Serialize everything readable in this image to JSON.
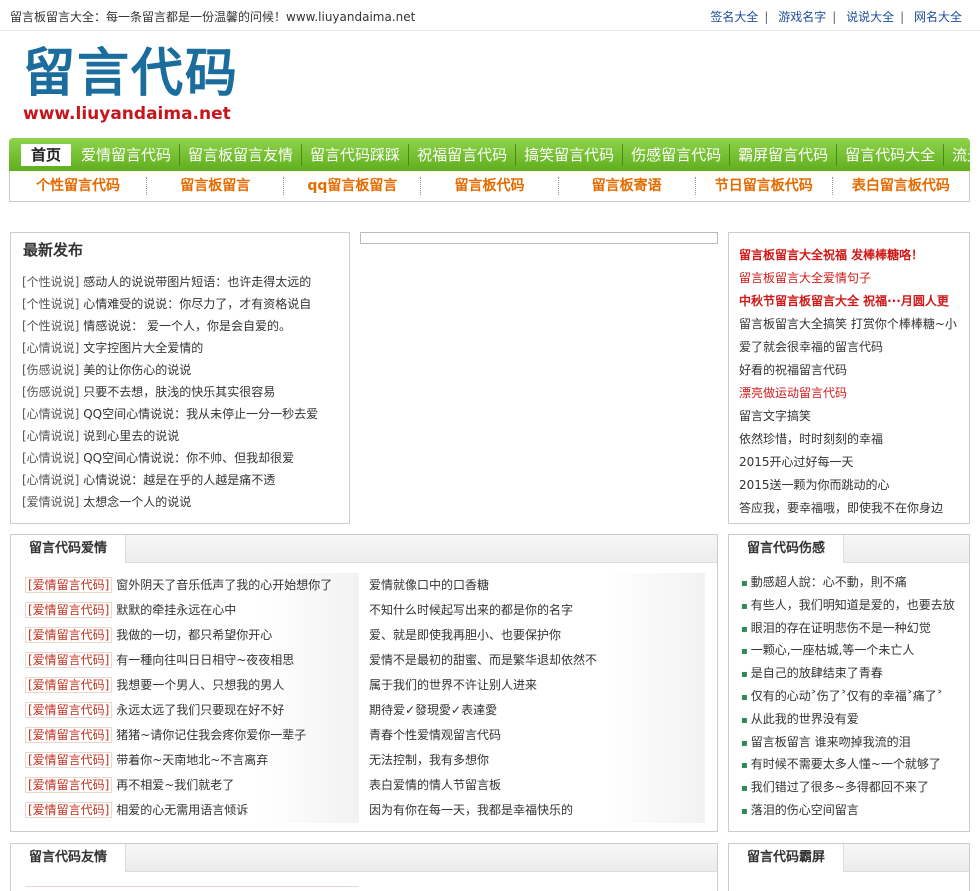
{
  "topbar": {
    "slogan": "留言板留言大全：每一条留言都是一份温馨的问候！www.liuyandaima.net",
    "links": [
      "签名大全",
      "游戏名字",
      "说说大全",
      "网名大全"
    ]
  },
  "logo": {
    "title": "留言代码",
    "url": "www.liuyandaima.net"
  },
  "nav": {
    "items": [
      "首页",
      "爱情留言代码",
      "留言板留言友情",
      "留言代码踩踩",
      "祝福留言代码",
      "搞笑留言代码",
      "伤感留言代码",
      "霸屏留言代码",
      "留言代码大全",
      "流光字"
    ]
  },
  "subnav": {
    "items": [
      "个性留言代码",
      "留言板留言",
      "qq留言板留言",
      "留言板代码",
      "留言板寄语",
      "节日留言板代码",
      "表白留言板代码"
    ]
  },
  "latest": {
    "title": "最新发布",
    "items": [
      {
        "cat": "[个性说说]",
        "text": " 感动人的说说带图片短语：也许走得太远的"
      },
      {
        "cat": "[个性说说]",
        "text": " 心情难受的说说：你尽力了，才有资格说自"
      },
      {
        "cat": "[个性说说]",
        "text": " 情感说说：  爱一个人，你是会自爱的。"
      },
      {
        "cat": "[心情说说]",
        "text": " 文字控图片大全爱情的"
      },
      {
        "cat": "[伤感说说]",
        "text": " 美的让你伤心的说说"
      },
      {
        "cat": "[伤感说说]",
        "text": " 只要不去想，肤浅的快乐其实很容易"
      },
      {
        "cat": "[心情说说]",
        "text": " QQ空间心情说说：我从未停止一分一秒去爱"
      },
      {
        "cat": "[心情说说]",
        "text": " 说到心里去的说说"
      },
      {
        "cat": "[心情说说]",
        "text": " QQ空间心情说说：你不帅、但我却很爱"
      },
      {
        "cat": "[心情说说]",
        "text": " 心情说说：越是在乎的人越是痛不透"
      },
      {
        "cat": "[爱情说说]",
        "text": " 太想念一个人的说说"
      }
    ]
  },
  "right_list": {
    "items": [
      {
        "text": "留言板留言大全祝福 发棒棒糖咯！",
        "red": true,
        "bold": true
      },
      {
        "text": "留言板留言大全爱情句子",
        "red": true,
        "bold": false
      },
      {
        "text": "中秋节留言板留言大全 祝福···月圆人更",
        "red": true,
        "bold": true
      },
      {
        "text": "留言板留言大全搞笑 打赏你个棒棒糖~小",
        "red": false,
        "bold": false
      },
      {
        "text": "爱了就会很幸福的留言代码",
        "red": false,
        "bold": false
      },
      {
        "text": "好看的祝福留言代码",
        "red": false,
        "bold": false
      },
      {
        "text": "漂亮做运动留言代码",
        "red": true,
        "bold": false
      },
      {
        "text": "留言文字搞笑",
        "red": false,
        "bold": false
      },
      {
        "text": "依然珍惜，时时刻刻的幸福",
        "red": false,
        "bold": false
      },
      {
        "text": "2015开心过好每一天",
        "red": false,
        "bold": false
      },
      {
        "text": "2015送一颗为你而跳动的心",
        "red": false,
        "bold": false
      },
      {
        "text": "答应我，要幸福哦，即使我不在你身边",
        "red": false,
        "bold": false
      }
    ]
  },
  "love": {
    "title": "留言代码爱情",
    "left": [
      {
        "cat": "[爱情留言代码]",
        "text": " 窗外阴天了音乐低声了我的心开始想你了"
      },
      {
        "cat": "[爱情留言代码]",
        "text": " 默默的牵挂永远在心中"
      },
      {
        "cat": "[爱情留言代码]",
        "text": " 我做的一切，都只希望你开心"
      },
      {
        "cat": "[爱情留言代码]",
        "text": " 有一種向往叫日日相守~夜夜相思"
      },
      {
        "cat": "[爱情留言代码]",
        "text": " 我想要一个男人、只想我的男人"
      },
      {
        "cat": "[爱情留言代码]",
        "text": " 永远太远了我们只要现在好不好"
      },
      {
        "cat": "[爱情留言代码]",
        "text": " 猪猪~请你记住我会疼你爱你一辈子"
      },
      {
        "cat": "[爱情留言代码]",
        "text": " 带着你~天南地北~不言离弃"
      },
      {
        "cat": "[爱情留言代码]",
        "text": " 再不相爱~我们就老了"
      },
      {
        "cat": "[爱情留言代码]",
        "text": " 相爱的心无需用语言倾诉"
      }
    ],
    "right": [
      "爱情就像口中的口香糖",
      "不知什么时候起写出来的都是你的名字",
      "爱、就是即使我再胆小、也要保护你",
      "爱情不是最初的甜蜜、而是繁华退却依然不",
      "属于我们的世界不许让别人进来",
      "期待爱✓發現愛✓表達愛",
      "青春个性爱情观留言代码",
      "无法控制，我有多想你",
      "表白爱情的情人节留言板",
      "因为有你在每一天，我都是幸福快乐的"
    ]
  },
  "sad": {
    "title": "留言代码伤感",
    "items": [
      "動感超人說：心不動，則不痛",
      "有些人，我们明知道是爱的，也要去放",
      "眼泪的存在证明悲伤不是一种幻觉",
      "一颗心,一座枯城,等一个未亡人",
      "是自己的放肆结束了青春",
      "仅有的心动˃伤了˃仅有的幸福˃痛了˃",
      "从此我的世界没有爱",
      "留言板留言 谁来吻掉我流的泪",
      "有时候不需要太多人懂~一个就够了",
      "我们错过了很多~多得都回不来了",
      "落泪的伤心空间留言"
    ]
  },
  "friend": {
    "title": "留言代码友情"
  },
  "screen": {
    "title": "留言代码霸屏"
  }
}
